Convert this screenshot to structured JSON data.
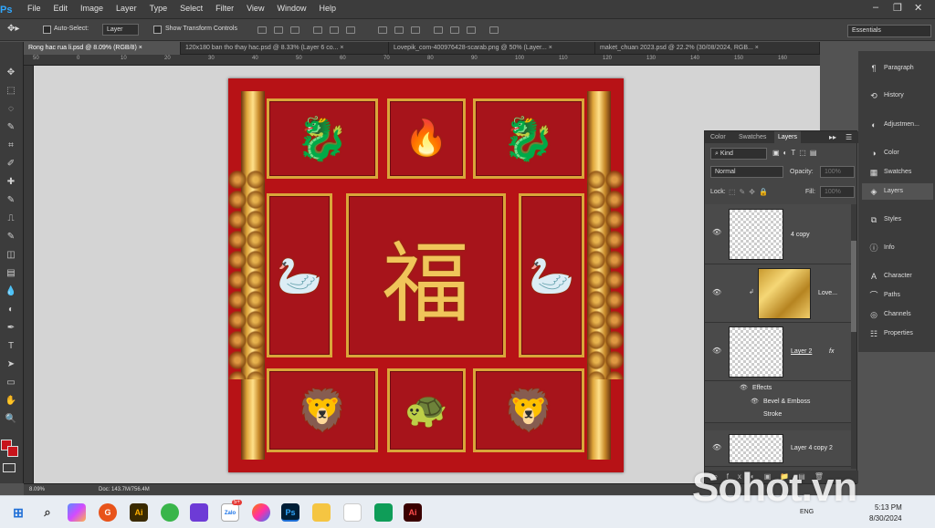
{
  "app": {
    "logo": "Ps"
  },
  "menu": [
    "File",
    "Edit",
    "Image",
    "Layer",
    "Type",
    "Select",
    "Filter",
    "View",
    "Window",
    "Help"
  ],
  "window_controls": {
    "minimize": "–",
    "restore": "❐",
    "close": "✕"
  },
  "options_bar": {
    "auto_select_label": "Auto-Select:",
    "auto_select_value": "Layer",
    "show_transform_label": "Show Transform Controls",
    "workspace": "Essentials"
  },
  "doc_tabs": [
    {
      "label": "Rong hac rua li.psd @ 8.09% (RGB/8)",
      "close": "×"
    },
    {
      "label": "120x180 ban tho thay hac.psd @ 8.33% (Layer 6 co...",
      "close": "×"
    },
    {
      "label": "Lovepik_com-400976428-scarab.png @ 50% (Layer...",
      "close": "×"
    },
    {
      "label": "maket_chuan 2023.psd @ 22.2% (30/08/2024, RGB...",
      "close": "×"
    }
  ],
  "ruler_ticks": [
    "50",
    "0",
    "10",
    "20",
    "30",
    "40",
    "50",
    "60",
    "70",
    "80",
    "90",
    "100",
    "110",
    "120",
    "130",
    "140",
    "150",
    "160",
    "170"
  ],
  "status": {
    "zoom": "8.09%",
    "doc": "Doc: 143.7M/756.4M"
  },
  "canvas": {
    "center_glyph": "福"
  },
  "tools": [
    "move-icon",
    "marquee-icon",
    "lasso-icon",
    "quick-select-icon",
    "crop-icon",
    "eyedropper-icon",
    "healing-icon",
    "brush-icon",
    "stamp-icon",
    "history-brush-icon",
    "eraser-icon",
    "gradient-icon",
    "blur-icon",
    "dodge-icon",
    "pen-icon",
    "type-icon",
    "path-select-icon",
    "shape-icon",
    "hand-icon",
    "zoom-icon"
  ],
  "tool_glyphs": [
    "✥",
    "⬚",
    "◌",
    "✎",
    "⌗",
    "✐",
    "✚",
    "✎",
    "⎍",
    "✎",
    "◫",
    "▤",
    "💧",
    "◐",
    "✒",
    "T",
    "➤",
    "▭",
    "✋",
    "🔍"
  ],
  "colors": {
    "foreground": "#c8141b",
    "background": "#c8141b",
    "accent": "#31a8ff"
  },
  "dock": [
    {
      "label": "Paragraph",
      "icon": "¶"
    },
    {
      "label": "History",
      "icon": "⟲"
    },
    {
      "label": "Adjustmen...",
      "icon": "◐"
    },
    {
      "label": "Color",
      "icon": "◑"
    },
    {
      "label": "Swatches",
      "icon": "▦"
    },
    {
      "label": "Layers",
      "icon": "◈"
    },
    {
      "label": "Styles",
      "icon": "⧉"
    },
    {
      "label": "Info",
      "icon": "ⓘ"
    },
    {
      "label": "Character",
      "icon": "A"
    },
    {
      "label": "Paths",
      "icon": "⌒"
    },
    {
      "label": "Channels",
      "icon": "◎"
    },
    {
      "label": "Properties",
      "icon": "☷"
    }
  ],
  "layers_panel": {
    "tabs": [
      "Color",
      "Swatches",
      "Layers"
    ],
    "filter_kind": "Kind",
    "blend_mode": "Normal",
    "opacity_label": "Opacity:",
    "opacity_value": "100%",
    "lock_label": "Lock:",
    "fill_label": "Fill:",
    "fill_value": "100%",
    "layers": [
      {
        "name": "4 copy"
      },
      {
        "name": "Love..."
      },
      {
        "name": "Layer 2",
        "fx": "fx"
      },
      {
        "name": "Layer 4 copy 2"
      }
    ],
    "effects_label": "Effects",
    "effect_items": [
      "Bevel & Emboss",
      "Stroke"
    ]
  },
  "taskbar": {
    "apps": [
      "G",
      "Ai",
      "Ps",
      "Ai"
    ],
    "lang": "ENG",
    "time": "5:13 PM",
    "date": "8/30/2024",
    "badge": "5+"
  },
  "watermark": "Sohot.vn"
}
